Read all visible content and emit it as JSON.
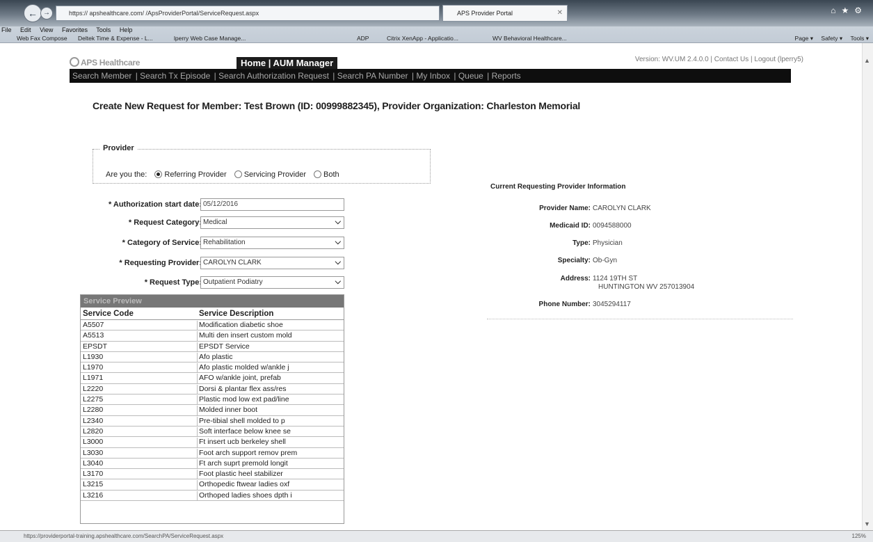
{
  "browser": {
    "address_text": "https://                          apshealthcare.com/                      /ApsProviderPortal/ServiceRequest.aspx",
    "tab_title": "APS Provider Portal",
    "menu_items": [
      "File",
      "Edit",
      "View",
      "Favorites",
      "Tools",
      "Help"
    ],
    "favorites": [
      "Web Fax Compose",
      "Deltek Time & Expense - L...",
      "lperry Web Case Manage...",
      "ADP",
      "Citrix XenApp - Applicatio...",
      "WV Behavioral Healthcare..."
    ],
    "tools": [
      "Page ▾",
      "Safety ▾",
      "Tools ▾"
    ],
    "status_url": "https://providerportal-training.apshealthcare.com/SearchPA/ServiceRequest.aspx",
    "zoom": "125%"
  },
  "app": {
    "logo": "APS Healthcare",
    "topnav": "Home | AUM Manager",
    "toplinks": "Version: WV.UM 2.4.0.0 | Contact Us | Logout (lperry5)",
    "menu": [
      "Search Member",
      "Search Tx Episode",
      "Search Authorization Request",
      "Search PA Number",
      "My Inbox",
      "Queue",
      "Reports"
    ]
  },
  "heading": "Create New Request for Member: Test Brown (ID: 00999882345), Provider Organization: Charleston Memorial",
  "provider_box": {
    "legend": "Provider",
    "question": "Are you the:",
    "options": [
      "Referring Provider",
      "Servicing Provider",
      "Both"
    ]
  },
  "form": {
    "auth_start_label": "* Authorization start date:",
    "auth_start_value": "05/12/2016",
    "category_label": "* Request Category:",
    "category_value": "Medical",
    "service_cat_label": "* Category of Service:",
    "service_cat_value": "Rehabilitation",
    "req_provider_label": "* Requesting Provider:",
    "req_provider_value": "CAROLYN CLARK",
    "req_type_label": "* Request Type:",
    "req_type_value": "Outpatient Podiatry"
  },
  "service_preview": {
    "title": "Service Preview",
    "col_code": "Service Code",
    "col_desc": "Service Description",
    "rows": [
      {
        "code": "A5507",
        "desc": "Modification diabetic shoe"
      },
      {
        "code": "A5513",
        "desc": "Multi den insert custom mold"
      },
      {
        "code": "EPSDT",
        "desc": "EPSDT Service"
      },
      {
        "code": "L1930",
        "desc": "Afo plastic"
      },
      {
        "code": "L1970",
        "desc": "Afo plastic molded w/ankle j"
      },
      {
        "code": "L1971",
        "desc": "AFO w/ankle joint, prefab"
      },
      {
        "code": "L2220",
        "desc": "Dorsi & plantar flex ass/res"
      },
      {
        "code": "L2275",
        "desc": "Plastic mod low ext pad/line"
      },
      {
        "code": "L2280",
        "desc": "Molded inner boot"
      },
      {
        "code": "L2340",
        "desc": "Pre-tibial shell molded to p"
      },
      {
        "code": "L2820",
        "desc": "Soft interface below knee se"
      },
      {
        "code": "L3000",
        "desc": "Ft insert ucb berkeley shell"
      },
      {
        "code": "L3030",
        "desc": "Foot arch support remov prem"
      },
      {
        "code": "L3040",
        "desc": "Ft arch suprt premold longit"
      },
      {
        "code": "L3170",
        "desc": "Foot plastic heel stabilizer"
      },
      {
        "code": "L3215",
        "desc": "Orthopedic ftwear ladies oxf"
      },
      {
        "code": "L3216",
        "desc": "Orthoped ladies shoes dpth i"
      }
    ]
  },
  "provider_info": {
    "title": "Current Requesting Provider Information",
    "name_label": "Provider Name:",
    "name_value": "CAROLYN CLARK",
    "medicaid_label": "Medicaid ID:",
    "medicaid_value": "0094588000",
    "type_label": "Type:",
    "type_value": "Physician",
    "specialty_label": "Specialty:",
    "specialty_value": "Ob-Gyn",
    "address_label": "Address:",
    "address_line1": "1124 19TH ST",
    "address_line2": "HUNTINGTON WV 257013904",
    "phone_label": "Phone Number:",
    "phone_value": "3045294117"
  }
}
